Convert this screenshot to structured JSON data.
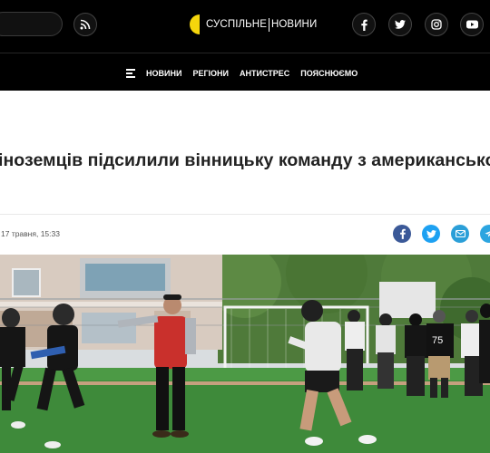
{
  "header": {
    "logo": {
      "part1": "СУСПІЛЬНЕ",
      "part2": "НОВИНИ"
    },
    "icons": [
      "search-icon",
      "rss-icon",
      "facebook-icon",
      "twitter-icon",
      "instagram-icon",
      "youtube-icon"
    ],
    "nav": [
      "НОВИНИ",
      "РЕГІОНИ",
      "АНТИСТРЕС",
      "ПОЯСНЮЄМО"
    ]
  },
  "article": {
    "title": "іноземців підсилили вінницьку команду з американського",
    "date": "17 травня, 15:33",
    "share_icons": [
      "facebook-share-icon",
      "twitter-share-icon",
      "email-share-icon",
      "telegram-share-icon"
    ],
    "photo": {
      "jersey_number": "75"
    }
  },
  "colors": {
    "brand_yellow": "#f5d60c",
    "facebook": "#3b5998",
    "twitter": "#1da1f2",
    "email": "#2b9fd8",
    "telegram": "#2ca5e0"
  }
}
